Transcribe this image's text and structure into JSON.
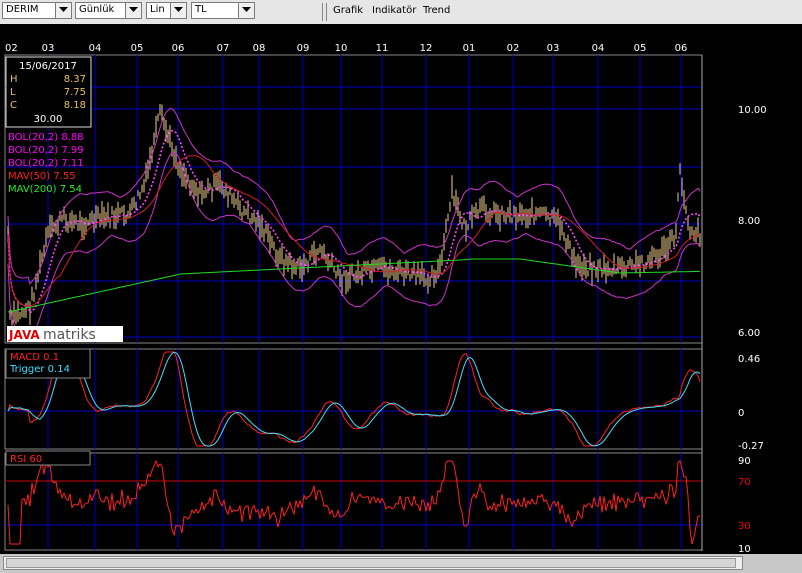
{
  "toolbar": {
    "symbol": "DERIM",
    "period": "Günlük",
    "scale": "Lin",
    "currency": "TL",
    "menu": [
      "Grafik",
      "Indikatör",
      "Trend"
    ]
  },
  "x_months": [
    "02",
    "03",
    "04",
    "05",
    "06",
    "07",
    "08",
    "09",
    "10",
    "11",
    "12",
    "01",
    "02",
    "03",
    "04",
    "05",
    "06"
  ],
  "info_box": {
    "date": "15/06/2017",
    "rows": [
      {
        "k": "H",
        "v": "8.37"
      },
      {
        "k": "L",
        "v": "7.75"
      },
      {
        "k": "C",
        "v": "8.18"
      }
    ],
    "volume": "30.00"
  },
  "price_panel": {
    "y_ticks": [
      "10.00",
      "8.00",
      "6.00"
    ],
    "legend": [
      {
        "text": "BOL(20,2) 8.88",
        "color": "#ff00ff"
      },
      {
        "text": "BOL(20,2) 7.99",
        "color": "#ff00ff"
      },
      {
        "text": "BOL(20,2) 7.11",
        "color": "#ff00ff"
      },
      {
        "text": "MAV(50) 7.55",
        "color": "#ff2020"
      },
      {
        "text": "MAV(200) 7.54",
        "color": "#22ee22"
      }
    ],
    "logo": {
      "java": "JAVA",
      "matriks": "matriks"
    }
  },
  "macd_panel": {
    "y_ticks": [
      "0.46",
      "0",
      "-0.27"
    ],
    "legend": [
      {
        "text": "MACD 0.1",
        "color": "#ff2020"
      },
      {
        "text": "Trigger 0.14",
        "color": "#40e0ff"
      }
    ]
  },
  "rsi_panel": {
    "y_ticks": [
      "90",
      "70",
      "30",
      "10"
    ],
    "legend": [
      {
        "text": "RSI 60",
        "color": "#ff2020"
      }
    ]
  },
  "colors": {
    "grid": "#0000c8",
    "price_bar": "#f0d08a",
    "bollinger": "#cc33cc",
    "bollinger_mid": "#ff44ff",
    "mav50": "#d02020",
    "mav200": "#22dd22",
    "macd": "#ff2020",
    "trigger": "#40e0ff",
    "rsi": "#ff2020",
    "rsi_levels": "#cc0000"
  }
}
